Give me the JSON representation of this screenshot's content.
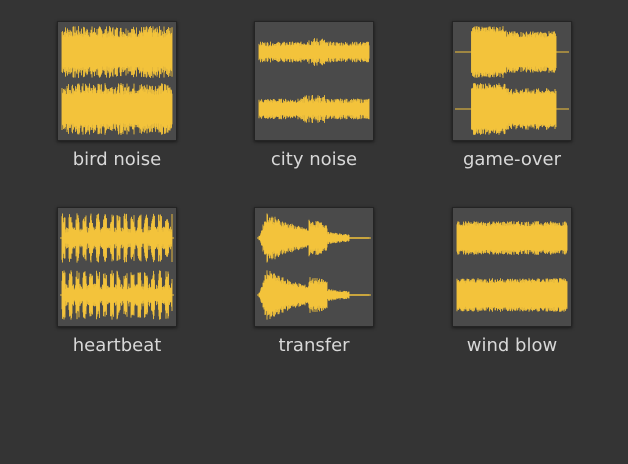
{
  "waveform_color": "#f3c33b",
  "files": [
    {
      "name": "bird noise",
      "icon": "waveform-icon",
      "style": "dense"
    },
    {
      "name": "city noise",
      "icon": "waveform-icon",
      "style": "thin"
    },
    {
      "name": "game-over",
      "icon": "waveform-icon",
      "style": "burst"
    },
    {
      "name": "heartbeat",
      "icon": "waveform-icon",
      "style": "pulse"
    },
    {
      "name": "transfer",
      "icon": "waveform-icon",
      "style": "decay"
    },
    {
      "name": "wind blow",
      "icon": "waveform-icon",
      "style": "band"
    }
  ]
}
